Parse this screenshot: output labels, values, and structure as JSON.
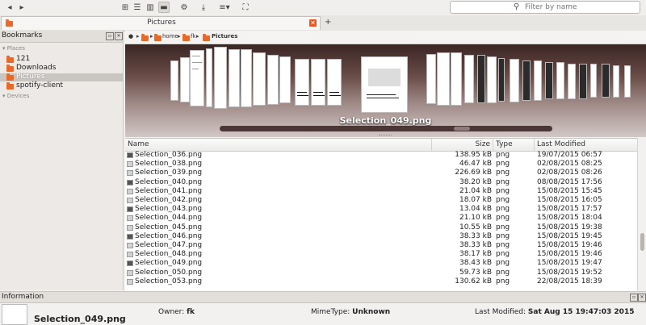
{
  "toolbar": {
    "back_icon": "arrow-left-icon",
    "forward_icon": "arrow-right-icon",
    "filter": {
      "placeholder": "Filter by name"
    }
  },
  "tab": {
    "title": "Pictures",
    "add_label": "+"
  },
  "sidebar": {
    "title": "Bookmarks",
    "places_label": "Places",
    "devices_label": "Devices",
    "items": [
      {
        "label": "121",
        "selected": false
      },
      {
        "label": "Downloads",
        "selected": false
      },
      {
        "label": "Pictures",
        "selected": true
      },
      {
        "label": "spotify-client",
        "selected": false
      }
    ]
  },
  "path": {
    "items": [
      "home",
      "fk",
      "Pictures"
    ]
  },
  "coverflow": {
    "caption": "Selection_049.png"
  },
  "filelist": {
    "columns": {
      "name": "Name",
      "size": "Size",
      "type": "Type",
      "modified": "Last Modified"
    },
    "rows": [
      {
        "name": "Selection_036.png",
        "size": "138.95 kB",
        "type": "png",
        "modified": "19/07/2015 06:57"
      },
      {
        "name": "Selection_038.png",
        "size": "46.47 kB",
        "type": "png",
        "modified": "02/08/2015 08:25"
      },
      {
        "name": "Selection_039.png",
        "size": "226.69 kB",
        "type": "png",
        "modified": "02/08/2015 08:26"
      },
      {
        "name": "Selection_040.png",
        "size": "38.20 kB",
        "type": "png",
        "modified": "08/08/2015 17:56"
      },
      {
        "name": "Selection_041.png",
        "size": "21.04 kB",
        "type": "png",
        "modified": "15/08/2015 15:45"
      },
      {
        "name": "Selection_042.png",
        "size": "18.07 kB",
        "type": "png",
        "modified": "15/08/2015 16:05"
      },
      {
        "name": "Selection_043.png",
        "size": "13.04 kB",
        "type": "png",
        "modified": "15/08/2015 17:57"
      },
      {
        "name": "Selection_044.png",
        "size": "21.10 kB",
        "type": "png",
        "modified": "15/08/2015 18:04"
      },
      {
        "name": "Selection_045.png",
        "size": "10.55 kB",
        "type": "png",
        "modified": "15/08/2015 19:38"
      },
      {
        "name": "Selection_046.png",
        "size": "38.33 kB",
        "type": "png",
        "modified": "15/08/2015 19:45"
      },
      {
        "name": "Selection_047.png",
        "size": "38.33 kB",
        "type": "png",
        "modified": "15/08/2015 19:46"
      },
      {
        "name": "Selection_048.png",
        "size": "38.17 kB",
        "type": "png",
        "modified": "15/08/2015 19:46"
      },
      {
        "name": "Selection_049.png",
        "size": "38.43 kB",
        "type": "png",
        "modified": "15/08/2015 19:47"
      },
      {
        "name": "Selection_050.png",
        "size": "59.73 kB",
        "type": "png",
        "modified": "15/08/2015 19:52"
      },
      {
        "name": "Selection_053.png",
        "size": "130.62 kB",
        "type": "png",
        "modified": "22/08/2015 18:39"
      }
    ]
  },
  "info": {
    "title": "Information",
    "filename": "Selection_049.png",
    "owner_label": "Owner:",
    "owner": "fk",
    "mime_label": "MimeType:",
    "mime": "Unknown",
    "modified_label": "Last Modified:",
    "modified": "Sat Aug 15 19:47:03 2015"
  },
  "colors": {
    "accent": "#e95420",
    "folder": "#e86a2a",
    "selection": "#c9c5c0"
  }
}
